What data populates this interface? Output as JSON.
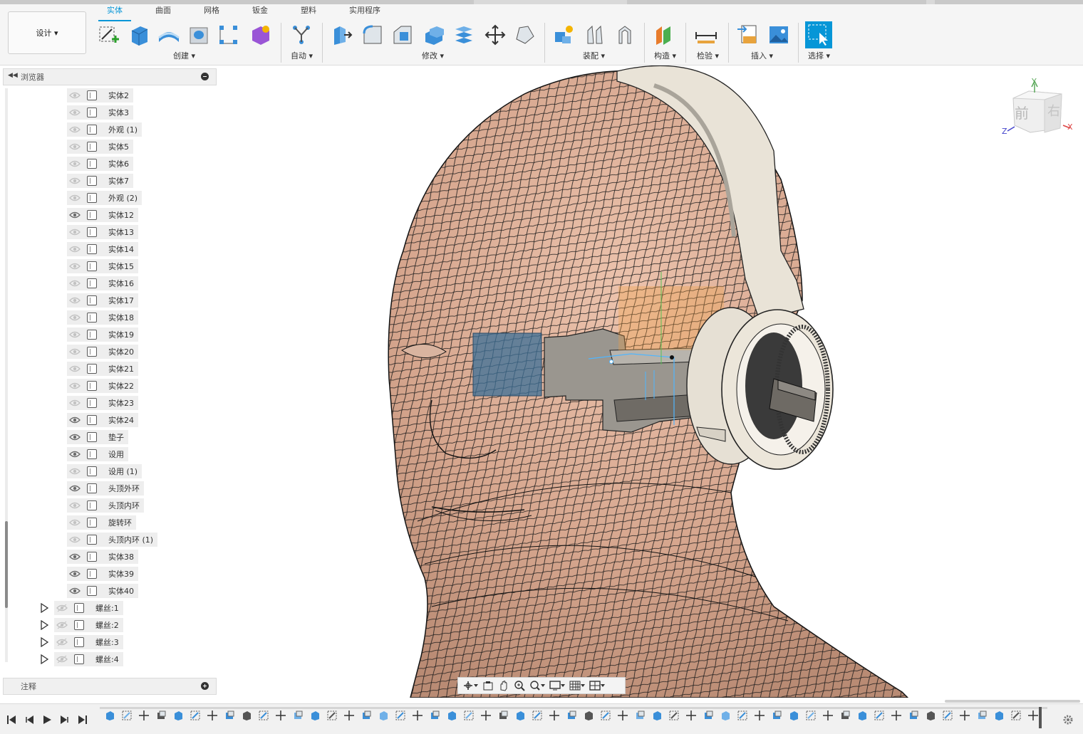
{
  "workspace": {
    "label": "设计 ▾"
  },
  "tabs": [
    "实体",
    "曲面",
    "网格",
    "钣金",
    "塑料",
    "实用程序"
  ],
  "active_tab": "实体",
  "groups": [
    {
      "label": "创建 ▾"
    },
    {
      "label": "自动 ▾"
    },
    {
      "label": "修改 ▾"
    },
    {
      "label": "装配 ▾"
    },
    {
      "label": "构造 ▾"
    },
    {
      "label": "检验 ▾"
    },
    {
      "label": "插入 ▾"
    },
    {
      "label": "选择 ▾"
    }
  ],
  "browser": {
    "title": "浏览器",
    "items": [
      {
        "label": "实体2",
        "visible": false
      },
      {
        "label": "实体3",
        "visible": false
      },
      {
        "label": "外观 (1)",
        "visible": false
      },
      {
        "label": "实体5",
        "visible": false
      },
      {
        "label": "实体6",
        "visible": false
      },
      {
        "label": "实体7",
        "visible": false
      },
      {
        "label": "外观 (2)",
        "visible": false
      },
      {
        "label": "实体12",
        "visible": true
      },
      {
        "label": "实体13",
        "visible": false
      },
      {
        "label": "实体14",
        "visible": false
      },
      {
        "label": "实体15",
        "visible": false
      },
      {
        "label": "实体16",
        "visible": false
      },
      {
        "label": "实体17",
        "visible": false
      },
      {
        "label": "实体18",
        "visible": false
      },
      {
        "label": "实体19",
        "visible": false
      },
      {
        "label": "实体20",
        "visible": false
      },
      {
        "label": "实体21",
        "visible": false
      },
      {
        "label": "实体22",
        "visible": false
      },
      {
        "label": "实体23",
        "visible": false
      },
      {
        "label": "实体24",
        "visible": true
      },
      {
        "label": "垫子",
        "visible": true
      },
      {
        "label": "设用",
        "visible": true
      },
      {
        "label": "设用 (1)",
        "visible": false
      },
      {
        "label": "头顶外环",
        "visible": true
      },
      {
        "label": "头顶内环",
        "visible": false
      },
      {
        "label": "旋转环",
        "visible": false
      },
      {
        "label": "头顶内环 (1)",
        "visible": false
      },
      {
        "label": "实体38",
        "visible": true
      },
      {
        "label": "实体39",
        "visible": true
      },
      {
        "label": "实体40",
        "visible": true
      }
    ],
    "components": [
      {
        "label": "螺丝:1"
      },
      {
        "label": "螺丝:2"
      },
      {
        "label": "螺丝:3"
      },
      {
        "label": "螺丝:4"
      }
    ]
  },
  "notes": {
    "title": "注释"
  },
  "viewcube": {
    "front": "前",
    "right": "右",
    "axis_x": "X",
    "axis_y": "Y",
    "axis_z": "Z"
  },
  "nav_tools": [
    "orbit-icon",
    "look-icon",
    "pan-icon",
    "zoom-icon",
    "fit-icon",
    "display-icon",
    "grid-icon",
    "viewports-icon"
  ],
  "colors": {
    "accent": "#0696d7",
    "skin": "#d8ab94",
    "headphone": "#e8e2d6"
  }
}
